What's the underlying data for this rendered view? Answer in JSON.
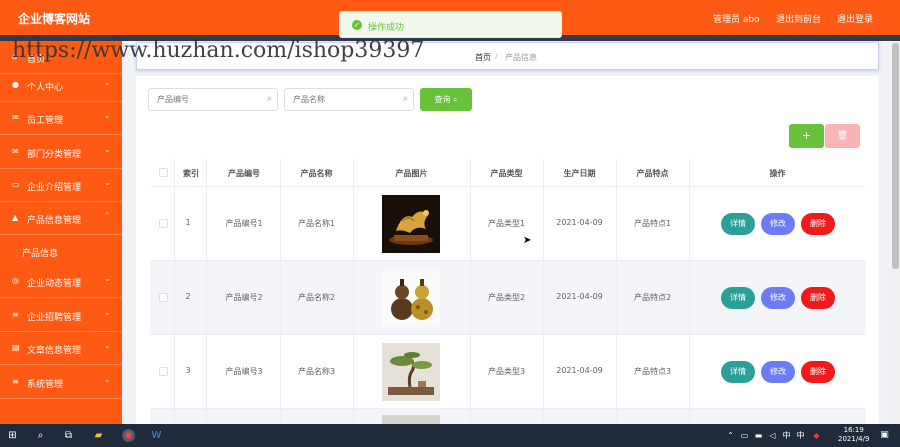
{
  "app": {
    "title": "企业博客网站",
    "admin_label": "管理员 abo",
    "back_label": "退出到前台",
    "logout_label": "退出登录"
  },
  "toast": {
    "message": "操作成功"
  },
  "watermark": "https://www.huzhan.com/ishop39397",
  "sidebar": {
    "items": [
      {
        "label": "首页",
        "icon": "home-icon"
      },
      {
        "label": "个人中心",
        "icon": "user-icon"
      },
      {
        "label": "员工管理",
        "icon": "mail-icon"
      },
      {
        "label": "部门分类管理",
        "icon": "mail-icon"
      },
      {
        "label": "企业介绍管理",
        "icon": "chat-icon"
      },
      {
        "label": "产品信息管理",
        "icon": "thumb-icon"
      },
      {
        "label": "企业动态管理",
        "icon": "globe-icon"
      },
      {
        "label": "企业招聘管理",
        "icon": "list-icon"
      },
      {
        "label": "文章信息管理",
        "icon": "doc-icon"
      },
      {
        "label": "系统管理",
        "icon": "list-icon"
      }
    ],
    "submenu": {
      "label": "产品信息"
    }
  },
  "breadcrumb": {
    "home": "首页",
    "separator": "/",
    "current": "产品信息"
  },
  "search": {
    "code_placeholder": "产品编号",
    "name_placeholder": "产品名称",
    "query_label": "查询"
  },
  "toolbar": {
    "add_label": "+",
    "delete_label": "🗑"
  },
  "table": {
    "columns": [
      "索引",
      "产品编号",
      "产品名称",
      "产品图片",
      "产品类型",
      "生产日期",
      "产品特点",
      "操作"
    ],
    "rows": [
      {
        "index": "1",
        "code": "产品编号1",
        "name": "产品名称1",
        "image": "dragon-figurine",
        "type": "产品类型1",
        "date": "2021-04-09",
        "feature": "产品特点1"
      },
      {
        "index": "2",
        "code": "产品编号2",
        "name": "产品名称2",
        "image": "gourd-ornaments",
        "type": "产品类型2",
        "date": "2021-04-09",
        "feature": "产品特点2"
      },
      {
        "index": "3",
        "code": "产品编号3",
        "name": "产品名称3",
        "image": "bonsai-tree",
        "type": "产品类型3",
        "date": "2021-04-09",
        "feature": "产品特点3"
      }
    ],
    "actions": {
      "detail": "详情",
      "edit": "修改",
      "delete": "删除"
    }
  },
  "taskbar": {
    "lang": "中",
    "time": "16:19",
    "date": "2021/4/9"
  },
  "colors": {
    "primary": "#ff5a14",
    "success": "#67c23a",
    "detail": "#2ba098",
    "edit": "#6b7cf6",
    "delete": "#f01a1a"
  }
}
